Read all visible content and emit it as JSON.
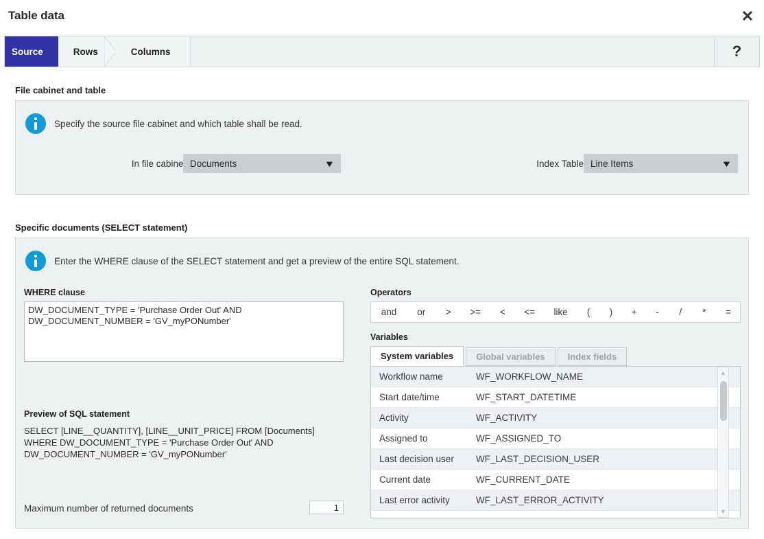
{
  "window": {
    "title": "Table data",
    "close_icon": "close-icon"
  },
  "wizard": {
    "tabs": [
      {
        "label": "Source",
        "active": true
      },
      {
        "label": "Rows",
        "active": false
      },
      {
        "label": "Columns",
        "active": false
      }
    ],
    "help_label": "?",
    "active_tab_color": "#3333a8"
  },
  "sections": {
    "file_cabinet": {
      "heading": "File cabinet and table",
      "info_text": "Specify the source file cabinet and which table shall be read.",
      "file_cabinet_label": "In file cabinet:",
      "file_cabinet_value": "Documents",
      "index_table_label": "Index Table",
      "index_table_value": "Line Items"
    },
    "specific_documents": {
      "heading": "Specific documents (SELECT statement)",
      "info_text": "Enter the WHERE clause of the SELECT statement and get a preview of the entire SQL statement.",
      "where_label": "WHERE clause",
      "where_value": "DW_DOCUMENT_TYPE = 'Purchase Order Out' AND\nDW_DOCUMENT_NUMBER = 'GV_myPONumber'",
      "preview_label": "Preview of SQL statement",
      "preview_value": "SELECT [LINE__QUANTITY], [LINE__UNIT_PRICE] FROM [Documents]\nWHERE DW_DOCUMENT_TYPE = 'Purchase Order Out' AND\nDW_DOCUMENT_NUMBER = 'GV_myPONumber'",
      "max_docs_label": "Maximum number of returned documents",
      "max_docs_value": "1"
    }
  },
  "operators": {
    "label": "Operators",
    "items": [
      "and",
      "or",
      ">",
      ">=",
      "<",
      "<=",
      "like",
      "(",
      ")",
      "+",
      "-",
      "/",
      "*",
      "="
    ]
  },
  "variables": {
    "label": "Variables",
    "tabs": [
      {
        "label": "System variables",
        "active": true
      },
      {
        "label": "Global variables",
        "active": false
      },
      {
        "label": "Index fields",
        "active": false
      }
    ],
    "rows": [
      {
        "name": "Workflow name",
        "code": "WF_WORKFLOW_NAME"
      },
      {
        "name": "Start date/time",
        "code": "WF_START_DATETIME"
      },
      {
        "name": "Activity",
        "code": "WF_ACTIVITY"
      },
      {
        "name": "Assigned to",
        "code": "WF_ASSIGNED_TO"
      },
      {
        "name": "Last decision user",
        "code": "WF_LAST_DECISION_USER"
      },
      {
        "name": "Current date",
        "code": "WF_CURRENT_DATE"
      },
      {
        "name": "Last error activity",
        "code": "WF_LAST_ERROR_ACTIVITY"
      }
    ],
    "scrollbar": {
      "up_icon": "triangle-up-icon",
      "down_icon": "triangle-down-icon"
    }
  }
}
